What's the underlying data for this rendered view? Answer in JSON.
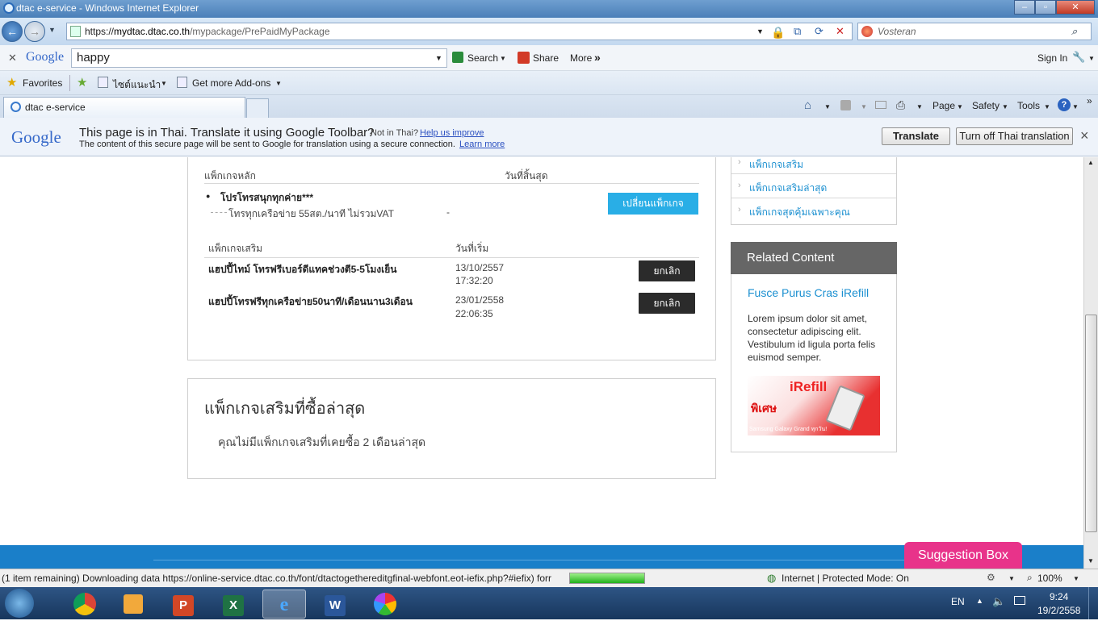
{
  "window": {
    "title": "dtac e-service - Windows Internet Explorer",
    "min_icon": "minimize-icon",
    "max_icon": "maximize-icon",
    "close_icon": "close-icon"
  },
  "address": {
    "protocol": "https://",
    "host": "mydtac.dtac.co.th",
    "path": "/mypackage/PrePaidMyPackage",
    "search_provider": "Vosteran"
  },
  "google_toolbar": {
    "logo": "Google",
    "search_value": "happy",
    "search_label": "Search",
    "share_label": "Share",
    "more_label": "More",
    "more_arrows": "»",
    "sign_in": "Sign In"
  },
  "favorites": {
    "favorites_label": "Favorites",
    "suggested_sites": "ไซต์แนะนำ",
    "addons": "Get more Add-ons"
  },
  "tabs": {
    "active_label": "dtac e-service"
  },
  "commandbar": {
    "page": "Page",
    "safety": "Safety",
    "tools": "Tools",
    "help": "?"
  },
  "translate_bar": {
    "logo": "Google",
    "message": "This page is in Thai.  Translate it using Google Toolbar?",
    "not_in_thai": "Not in Thai?",
    "help_link": "Help us improve",
    "secure_note": "The content of this secure page will be sent to Google for translation using a secure connection.",
    "learn_more": "Learn more",
    "translate_btn": "Translate",
    "turn_off_btn": "Turn off Thai translation",
    "close": "×"
  },
  "main_package": {
    "header_left": "แพ็กเกจหลัก",
    "header_right": "วันที่สิ้นสุด",
    "name": "โปรโทรสนุกทุกค่าย***",
    "detail": "โทรทุกเครือข่าย 55สต./นาที ไม่รวมVAT",
    "end_date": "-",
    "change_btn": "เปลี่ยนแพ็กเกจ"
  },
  "addon_packages": {
    "header_left": "แพ็กเกจเสริม",
    "header_right": "วันที่เริ่ม",
    "items": [
      {
        "name": "แฮปปี้ไทม์ โทรฟรีเบอร์ดีแทคช่วงตี5-5โมงเย็น",
        "date": "13/10/2557",
        "time": "17:32:20",
        "cancel": "ยกเลิก"
      },
      {
        "name": "แฮปปี้โทรฟรีทุกเครือข่าย50นาที/เดือนนาน3เดือน",
        "date": "23/01/2558",
        "time": "22:06:35",
        "cancel": "ยกเลิก"
      }
    ]
  },
  "recent_addons": {
    "title": "แพ็กเกจเสริมที่ซื้อล่าสุด",
    "empty_message": "คุณไม่มีแพ็กเกจเสริมที่เคยซื้อ 2 เดือนล่าสุด"
  },
  "side_menu": {
    "items": [
      "แพ็กเกจเสริม",
      "แพ็กเกจเสริมล่าสุด",
      "แพ็กเกจสุดคุ้มเฉพาะคุณ"
    ]
  },
  "related": {
    "header": "Related Content",
    "link": "Fusce Purus Cras iRefill",
    "body": "Lorem ipsum dolor sit amet, consectetur adipiscing elit. Vestibulum id ligula porta felis euismod semper.",
    "banner_title": "iRefill",
    "banner_tag": "พิเศษ",
    "banner_sub": "Samsung Galaxy Grand ทุกวัน!"
  },
  "suggestion_box": "Suggestion Box",
  "status": {
    "message": "(1 item remaining) Downloading data https://online-service.dtac.co.th/font/dtactogethereditgfinal-webfont.eot-iefix.php?#iefix) forr",
    "progress": 1.0,
    "zone": "Internet | Protected Mode: On",
    "zoom": "100%"
  },
  "taskbar": {
    "lang": "EN",
    "time": "9:24",
    "date": "19/2/2558",
    "apps": [
      "chrome",
      "media-player",
      "powerpoint",
      "excel",
      "internet-explorer",
      "word",
      "pinwheel"
    ]
  },
  "colors": {
    "accent": "#1a7fc9",
    "change_btn": "#29aee6",
    "dark_btn": "#2b2b2b",
    "related_header": "#666666",
    "suggestion": "#e8338a"
  }
}
